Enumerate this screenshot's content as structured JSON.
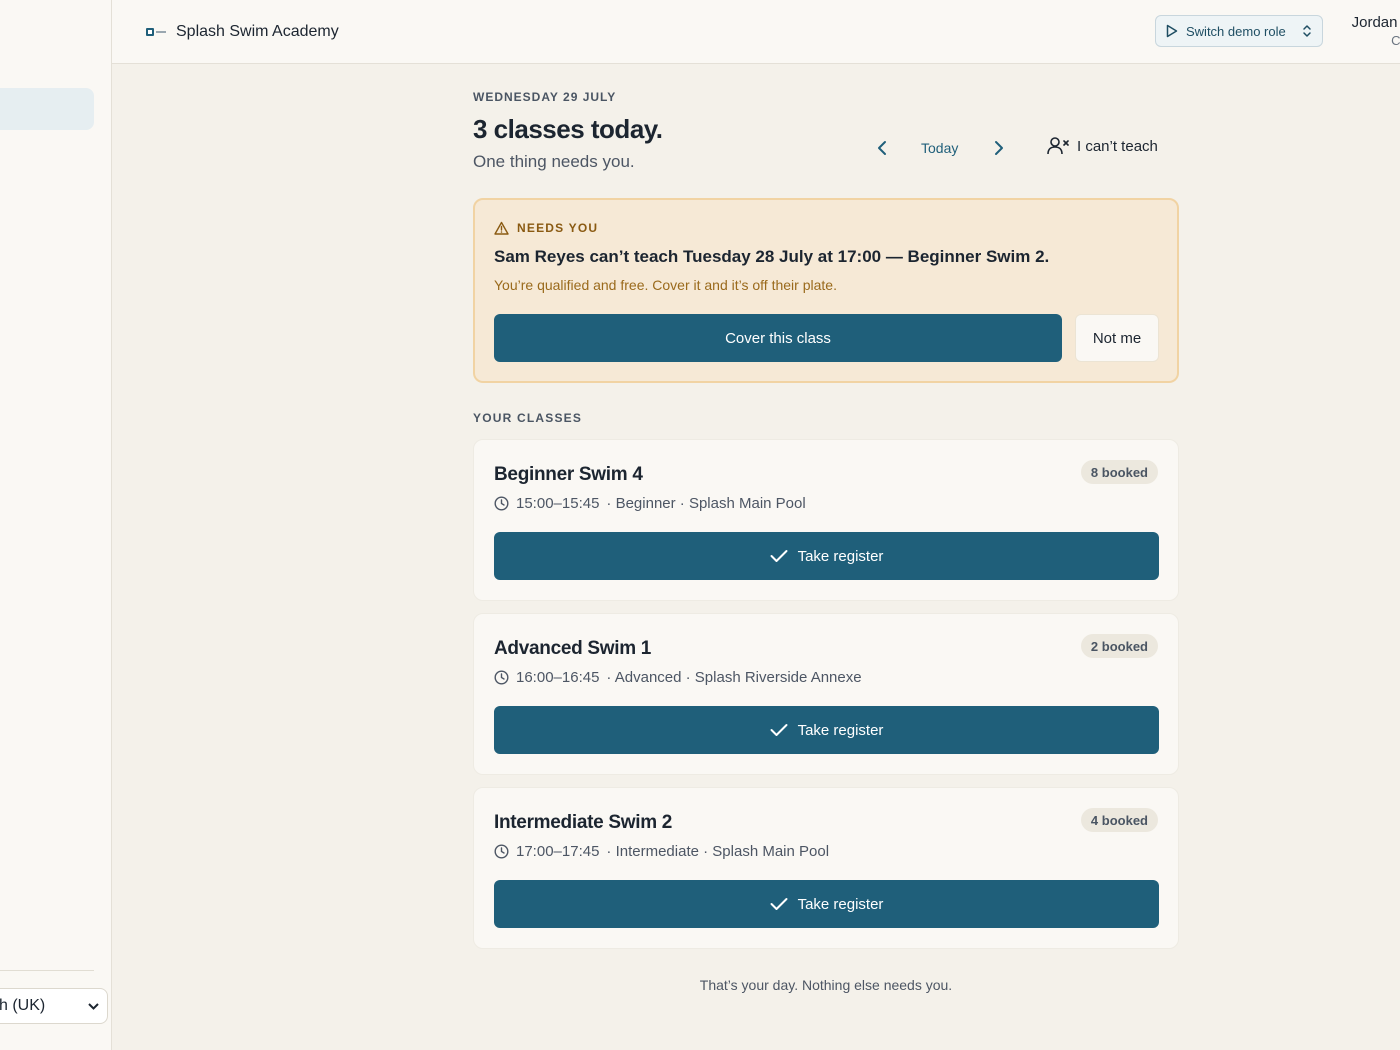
{
  "sidebar": {
    "language_select_value": "h (UK)"
  },
  "header": {
    "brand_name": "Splash Swim Academy",
    "role_button_label": "Switch demo role",
    "user_name": "Jordan Pi",
    "user_role": "Coa"
  },
  "main": {
    "date_label": "WEDNESDAY 29 JULY",
    "headline": "3 classes today.",
    "subhead": "One thing needs you.",
    "nav_today": "Today",
    "cant_teach_label": "I can’t teach"
  },
  "alert": {
    "tag": "NEEDS YOU",
    "title": "Sam Reyes can’t teach Tuesday 28 July at 17:00 — Beginner Swim 2.",
    "text": "You’re qualified and free. Cover it and it’s off their plate.",
    "cover_button": "Cover this class",
    "decline_button": "Not me"
  },
  "section_label": "YOUR CLASSES",
  "classes": [
    {
      "title": "Beginner Swim 4",
      "time": "15:00–15:45",
      "details": "· Beginner · Splash Main Pool",
      "booked": "8 booked",
      "action": "Take register"
    },
    {
      "title": "Advanced Swim 1",
      "time": "16:00–16:45",
      "details": "· Advanced · Splash Riverside Annexe",
      "booked": "2 booked",
      "action": "Take register"
    },
    {
      "title": "Intermediate Swim 2",
      "time": "17:00–17:45",
      "details": "· Intermediate · Splash Main Pool",
      "booked": "4 booked",
      "action": "Take register"
    }
  ],
  "footer_note": "That’s your day. Nothing else needs you.",
  "colors": {
    "primary": "#1f5f7a",
    "alert_bg": "#f6e9d6",
    "alert_border": "#f1d3a3",
    "alert_accent": "#8a5a12",
    "page_bg": "#f4f1ea"
  }
}
